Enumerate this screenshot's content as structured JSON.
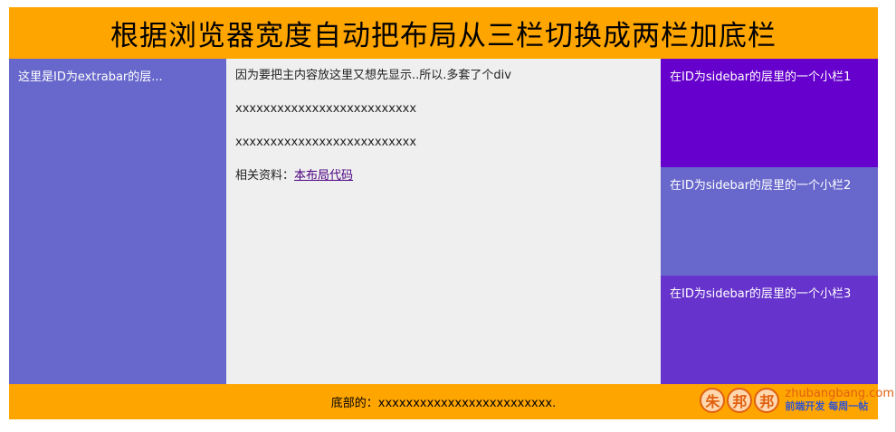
{
  "header": {
    "title": "根据浏览器宽度自动把布局从三栏切换成两栏加底栏"
  },
  "extrabar": {
    "text": "这里是ID为extrabar的层..."
  },
  "main": {
    "intro": "因为要把主内容放这里又想先显示..所以.多套了个div",
    "line1": "xxxxxxxxxxxxxxxxxxxxxxxxxx",
    "line2": "xxxxxxxxxxxxxxxxxxxxxxxxxx",
    "ref_label": "相关资料：",
    "ref_link": "本布局代码"
  },
  "sidebar": {
    "boxes": [
      {
        "text": "在ID为sidebar的层里的一个小栏1",
        "color": "#6600cc"
      },
      {
        "text": "在ID为sidebar的层里的一个小栏2",
        "color": "#6868cc"
      },
      {
        "text": "在ID为sidebar的层里的一个小栏3",
        "color": "#6633cc"
      }
    ]
  },
  "footer": {
    "text": "底部的：xxxxxxxxxxxxxxxxxxxxxxxxx."
  },
  "watermark": {
    "chars": [
      "朱",
      "邦",
      "邦"
    ],
    "domain": "zhubangbang.com",
    "slogan": "前端开发 每周一帖"
  },
  "colors": {
    "header_bg": "#ffa500",
    "extrabar_bg": "#6868cc",
    "main_bg": "#efefef",
    "footer_bg": "#ffa500"
  }
}
